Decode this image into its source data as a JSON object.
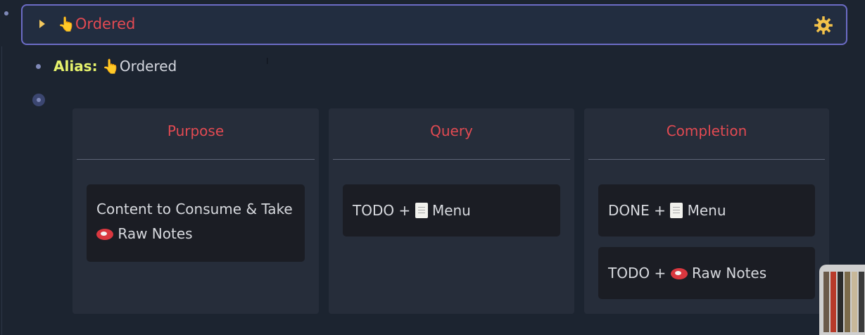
{
  "page": {
    "title": "Ordered",
    "hand_glyph": "👆",
    "gear_icon": "gear-icon",
    "colors": {
      "title": "#e24a52",
      "border": "#6c6cc6",
      "alias_key": "#e6f26c",
      "background": "#1c2430"
    }
  },
  "alias": {
    "key": "Alias:",
    "value": "Ordered"
  },
  "columns": [
    {
      "header": "Purpose",
      "cards": [
        {
          "line1": "Content to Consume & Take",
          "line2_label": "Raw Notes",
          "icon": "meat-icon"
        }
      ]
    },
    {
      "header": "Query",
      "cards": [
        {
          "prefix": "TODO +",
          "label": "Menu",
          "icon": "document-icon"
        }
      ]
    },
    {
      "header": "Completion",
      "cards": [
        {
          "prefix": "DONE +",
          "label": "Menu",
          "icon": "document-icon"
        },
        {
          "prefix": "TODO +",
          "label": "Raw Notes",
          "icon": "meat-icon"
        }
      ]
    }
  ]
}
